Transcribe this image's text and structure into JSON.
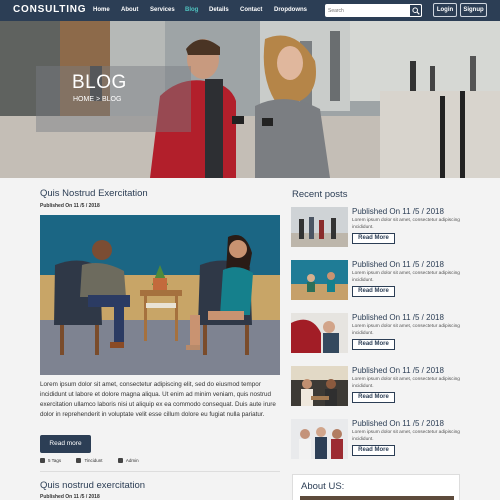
{
  "nav": {
    "brand": "CONSULTING",
    "items": [
      "Home",
      "About",
      "Services",
      "Blog",
      "Details",
      "Contact",
      "Dropdowns"
    ],
    "active_index": 3,
    "search_placeholder": "Search",
    "login": "Login",
    "signup": "Signup"
  },
  "hero": {
    "title": "BLOG",
    "breadcrumb": "HOME  > BLOG"
  },
  "posts": [
    {
      "title": "Quis Nostrud Exercitation",
      "published": "Published On 11 /5 / 2018",
      "excerpt": "Lorem ipsum dolor sit amet, consectetur adipiscing elit, sed do eiusmod tempor incididunt ut labore et dolore magna aliqua. Ut enim ad minim veniam, quis nostrud exercitation ullamco laboris nisi ut aliquip ex ea commodo consequat. Duis aute irure dolor in reprehenderit in voluptate velit esse cillum dolore eu fugiat nulla pariatur.",
      "read_more": "Read more",
      "tags": "5 Tags",
      "category": "Tincidunt",
      "author": "Admin"
    },
    {
      "title": "Quis nostrud exercitation",
      "published": "Published On 11 /5 / 2018"
    }
  ],
  "sidebar": {
    "recent_title": "Recent posts",
    "recent": [
      {
        "date": "Published On 11 /5 / 2018",
        "text": "Lorem ipsum dolor sit amet, consectetur adipiscing incididunt.",
        "button": "Read More"
      },
      {
        "date": "Published On 11 /5 / 2018",
        "text": "Lorem ipsum dolor sit amet, consectetur adipiscing incididunt.",
        "button": "Read More"
      },
      {
        "date": "Published On 11 /5 / 2018",
        "text": "Lorem ipsum dolor sit amet, consectetur adipiscing incididunt.",
        "button": "Read More"
      },
      {
        "date": "Published On 11 /5 / 2018",
        "text": "Lorem ipsum dolor sit amet, consectetur adipiscing incididunt.",
        "button": "Read More"
      },
      {
        "date": "Published On 11 /5 / 2018",
        "text": "Lorem ipsum dolor sit amet, consectetur adipiscing incididunt.",
        "button": "Read More"
      }
    ],
    "about_title": "About US:"
  },
  "colors": {
    "navy": "#2c3e55",
    "accent": "#4fc3c0"
  }
}
